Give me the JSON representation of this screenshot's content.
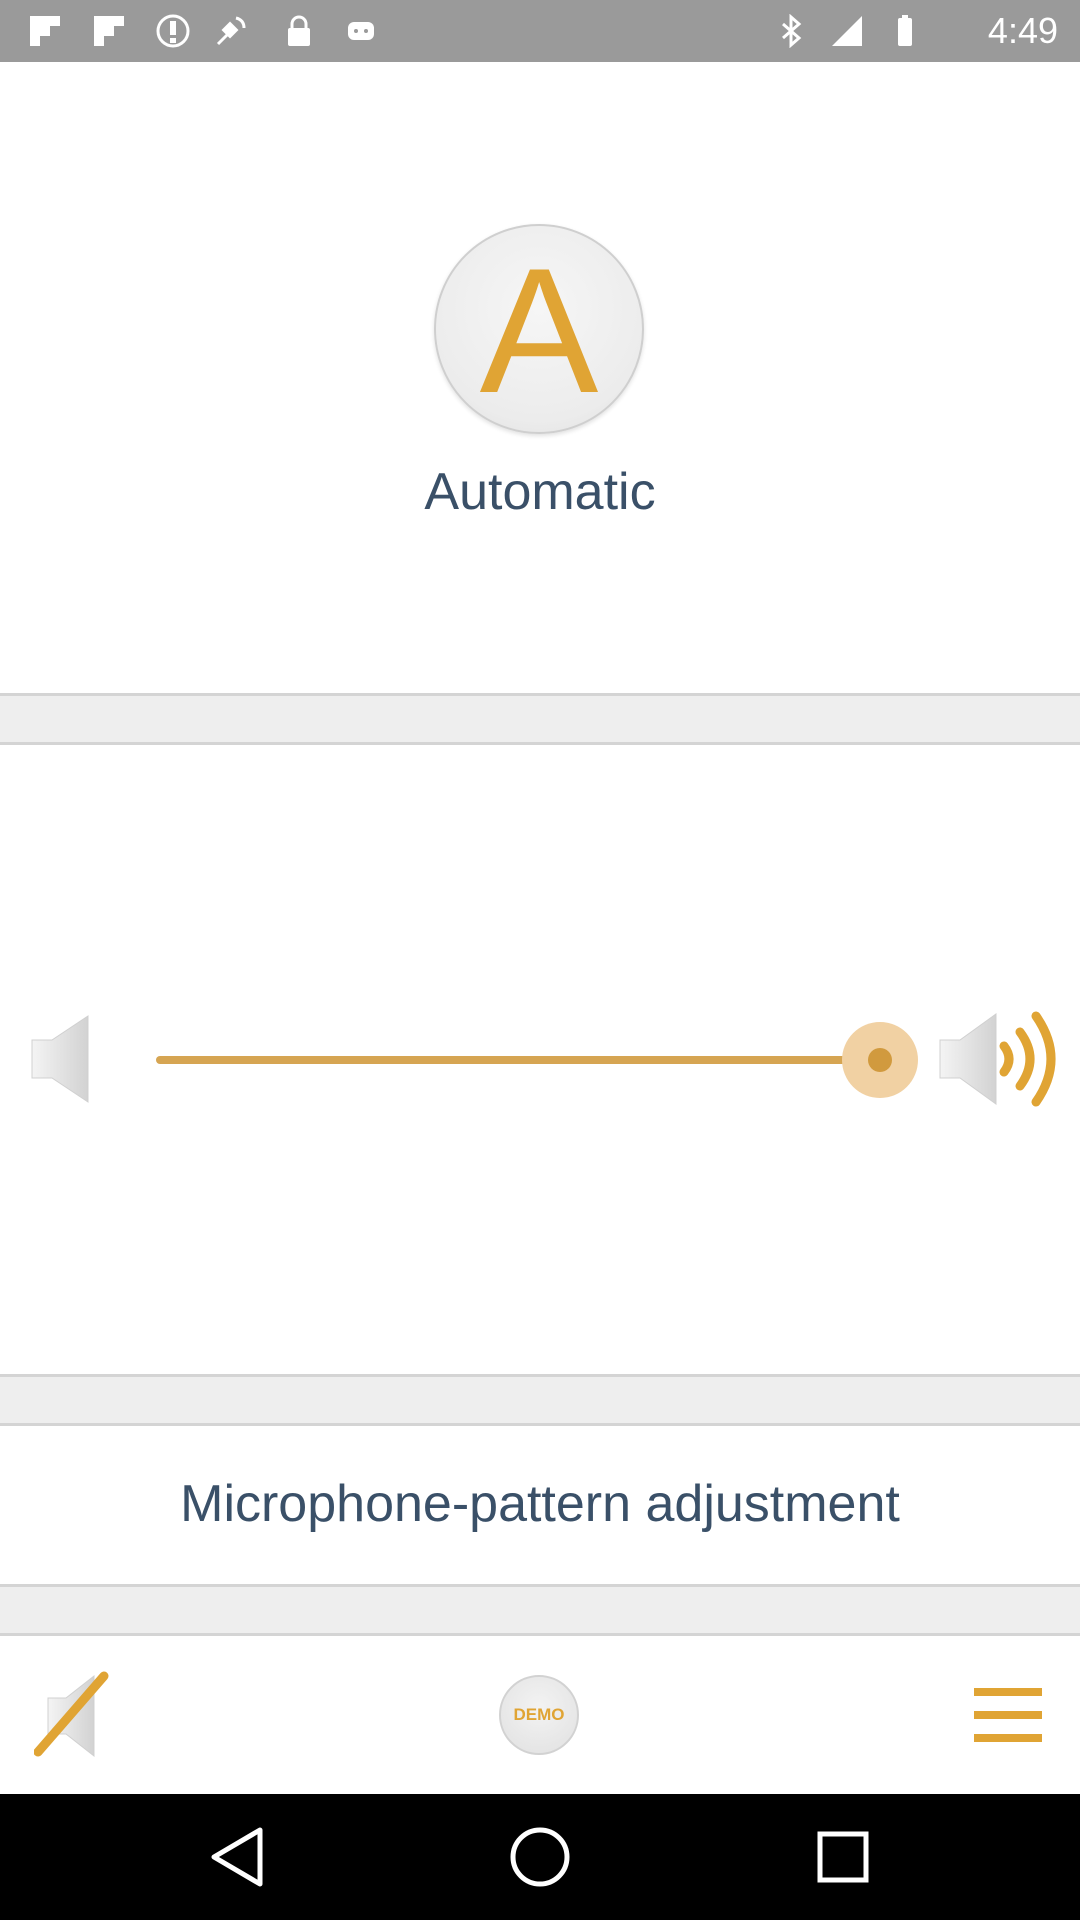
{
  "status_bar": {
    "time": "4:49",
    "left_icons": [
      "flipboard-icon",
      "flipboard-icon",
      "alert-icon",
      "fake-gps-icon",
      "lock-icon",
      "android-icon"
    ],
    "right_icons": [
      "bluetooth-icon",
      "signal-icon",
      "battery-icon"
    ]
  },
  "mode": {
    "letter": "A",
    "label": "Automatic"
  },
  "volume": {
    "level_fraction": 0.95
  },
  "title": "Microphone-pattern adjustment",
  "toolbar": {
    "demo_label": "DEMO"
  },
  "colors": {
    "accent": "#e0a434",
    "text": "#3a5068",
    "status_bar": "#9a9a9a"
  }
}
